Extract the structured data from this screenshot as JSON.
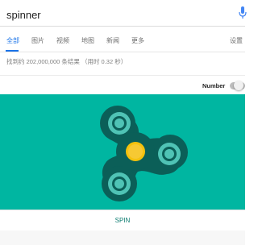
{
  "search": {
    "query": "spinner"
  },
  "tabs": [
    {
      "label": "全部",
      "active": true
    },
    {
      "label": "图片",
      "active": false
    },
    {
      "label": "视频",
      "active": false
    },
    {
      "label": "地图",
      "active": false
    },
    {
      "label": "新闻",
      "active": false
    },
    {
      "label": "更多",
      "active": false
    }
  ],
  "settings_label": "设置",
  "results_stats": "找到约 202,000,000 条结果 （用时 0.32 秒）",
  "widget": {
    "number_label": "Number",
    "toggle_on": false,
    "spin_label": "SPIN",
    "colors": {
      "background": "#00b6a1",
      "body": "#0b5f58",
      "bearing_ring": "#4fc3b5",
      "bearing_core": "#0b5f58",
      "center": "#f4c20d",
      "accent": "#0b7b6f"
    }
  }
}
